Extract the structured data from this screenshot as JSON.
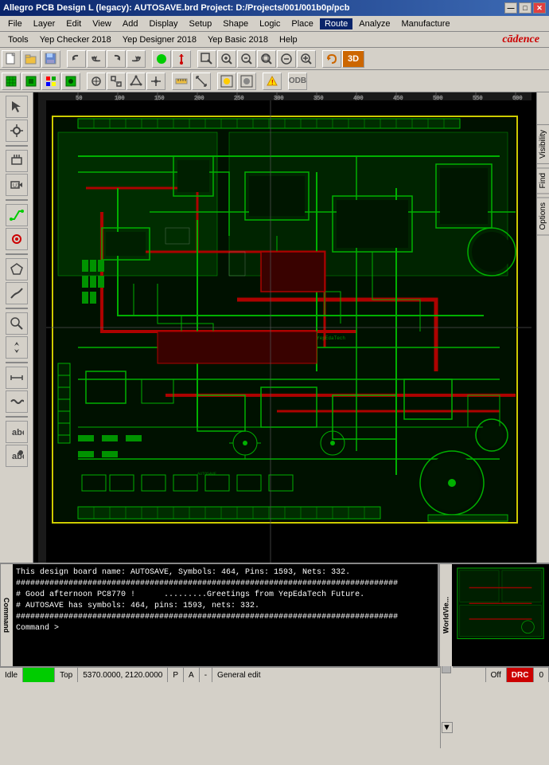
{
  "title_bar": {
    "title": "Allegro PCB Design L (legacy): AUTOSAVE.brd  Project: D:/Projects/001/001b0p/pcb",
    "minimize": "—",
    "maximize": "□",
    "close": "✕"
  },
  "menu_bar1": {
    "items": [
      "File",
      "Layer",
      "Edit",
      "View",
      "Add",
      "Display",
      "Setup",
      "Shape",
      "Logic",
      "Place",
      "Route",
      "Analyze",
      "Manufacture"
    ]
  },
  "menu_bar2": {
    "items": [
      "Tools",
      "Yep Checker 2018",
      "Yep Designer 2018",
      "Yep Basic 2018",
      "Help"
    ],
    "logo": "cādence"
  },
  "right_panel": {
    "tabs": [
      "Visibility",
      "Find",
      "Options"
    ]
  },
  "command_panel": {
    "label": "Command >",
    "lines": [
      "This design board name: AUTOSAVE, Symbols: 464, Pins: 1593, Nets: 332.",
      "################################################################################",
      "# Good afternoon PC8770 !      .........Greetings from YepEdaTech Future.",
      "# AUTOSAVE has symbols: 464, pins: 1593, nets: 332.",
      "################################################################################",
      "Command >"
    ]
  },
  "status_bar": {
    "mode": "Idle",
    "green_indicator": "",
    "view": "Top",
    "coordinates": "5370.0000, 2120.0000",
    "pa_label": "P",
    "al_label": "A",
    "separator": "-",
    "edit_mode": "General edit",
    "off_label": "Off",
    "drc_label": "DRC",
    "counter": "0"
  },
  "toolbar1": {
    "buttons": [
      "new",
      "open",
      "save",
      "sep",
      "undo-redo",
      "undo",
      "redo-back",
      "redo",
      "sep",
      "select",
      "add-connect",
      "sep",
      "zoom-in",
      "zoom-out",
      "zoom-fit",
      "zoom-prev",
      "zoom-next",
      "sep",
      "refresh"
    ]
  },
  "toolbar2": {
    "buttons": [
      "grid-toggle",
      "grid2",
      "color-grid",
      "grid3",
      "sep",
      "snap-on",
      "snap2",
      "snap3",
      "snap4",
      "sep",
      "ruler",
      "measure",
      "sep",
      "highlight",
      "dehigh",
      "sep",
      "drc",
      "sep",
      "odd"
    ]
  }
}
